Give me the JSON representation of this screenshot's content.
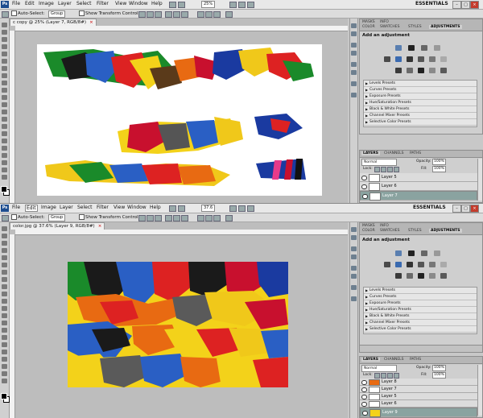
{
  "menu": {
    "app_logo": "Ps",
    "items": [
      "File",
      "Edit",
      "Image",
      "Layer",
      "Select",
      "Filter",
      "View",
      "Window",
      "Help"
    ],
    "zoom_top": "25%",
    "zoom_bottom": "37.6",
    "workspace": "ESSENTIALS"
  },
  "options_bar": {
    "auto_select_label": "Auto-Select:",
    "auto_select_value": "Group",
    "transform_label": "Show Transform Controls"
  },
  "window1": {
    "doc_tab": "c copy @ 25% (Layer 7, RGB/8#)",
    "adjust_tabs": [
      "MASKS",
      "INFO",
      "COLOR",
      "SWATCHES",
      "STYLES",
      "ADJUSTMENTS"
    ],
    "adjust_title": "Add an adjustment",
    "presets": [
      "Levels Presets",
      "Curves Presets",
      "Exposure Presets",
      "Hue/Saturation Presets",
      "Black & White Presets",
      "Channel Mixer Presets",
      "Selective Color Presets"
    ],
    "layers_tabs": [
      "LAYERS",
      "CHANNELS",
      "PATHS"
    ],
    "blend_mode": "Normal",
    "opacity_label": "Opacity:",
    "opacity_value": "100%",
    "lock_label": "Lock:",
    "fill_label": "Fill:",
    "fill_value": "100%",
    "layers": [
      {
        "name": "Layer 5",
        "selected": false
      },
      {
        "name": "Layer 6",
        "selected": false
      },
      {
        "name": "Layer 7",
        "selected": true
      }
    ]
  },
  "window2": {
    "doc_tab": "color.jpg @ 37.6% (Layer 9, RGB/8#)",
    "adjust_tabs": [
      "MASKS",
      "INFO",
      "COLOR",
      "SWATCHES",
      "STYLES",
      "ADJUSTMENTS"
    ],
    "adjust_title": "Add an adjustment",
    "presets": [
      "Levels Presets",
      "Curves Presets",
      "Exposure Presets",
      "Hue/Saturation Presets",
      "Black & White Presets",
      "Channel Mixer Presets",
      "Selective Color Presets"
    ],
    "layers_tabs": [
      "LAYERS",
      "CHANNELS",
      "PATHS"
    ],
    "blend_mode": "Normal",
    "opacity_label": "Opacity:",
    "opacity_value": "100%",
    "lock_label": "Lock:",
    "fill_label": "Fill:",
    "fill_value": "100%",
    "layers": [
      {
        "name": "Layer 8",
        "selected": false
      },
      {
        "name": "Layer 7",
        "selected": false
      },
      {
        "name": "Layer 5",
        "selected": false
      },
      {
        "name": "Layer 6",
        "selected": false
      },
      {
        "name": "Layer 9",
        "selected": true
      }
    ]
  },
  "colors": {
    "app_blue": "#1d4d8f",
    "selected_layer": "#8aa3a0",
    "close_red": "#c43c2c"
  }
}
